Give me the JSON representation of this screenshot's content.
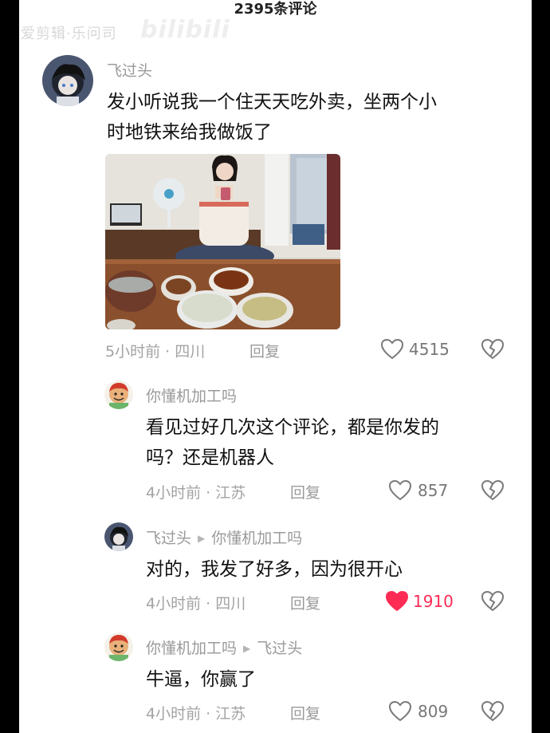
{
  "header": {
    "comment_count": "2395条评论"
  },
  "watermark": {
    "text": "爱剪辑·乐问司",
    "logo": "bilibili"
  },
  "comments": [
    {
      "user": "飞过头",
      "text_line1": "发小听说我一个住天天吃外卖，坐两个小",
      "text_line2": "时地铁来给我做饭了",
      "time": "5小时前 · 四川",
      "reply": "回复",
      "likes": "4515",
      "liked": false,
      "has_photo": true
    }
  ],
  "replies": [
    {
      "user": "你懂机加工吗",
      "reply_to": "",
      "text_line1": "看见过好几次这个评论，都是你发的",
      "text_line2": "吗？还是机器人",
      "time": "4小时前 · 江苏",
      "reply": "回复",
      "likes": "857",
      "liked": false
    },
    {
      "user": "飞过头",
      "reply_to": "你懂机加工吗",
      "text_line1": "对的，我发了好多，因为很开心",
      "time": "4小时前 · 四川",
      "reply": "回复",
      "likes": "1910",
      "liked": true
    },
    {
      "user": "你懂机加工吗",
      "reply_to": "飞过头",
      "text_line1": "牛逼，你赢了",
      "time": "4小时前 · 江苏",
      "reply": "回复",
      "likes": "809",
      "liked": false
    }
  ],
  "colors": {
    "liked": "#fe2c55",
    "meta": "#a3a3a3",
    "username": "#9a9a9a"
  },
  "icons": {
    "like": "heart-outline-icon",
    "liked": "heart-filled-icon",
    "dislike": "broken-heart-icon"
  }
}
